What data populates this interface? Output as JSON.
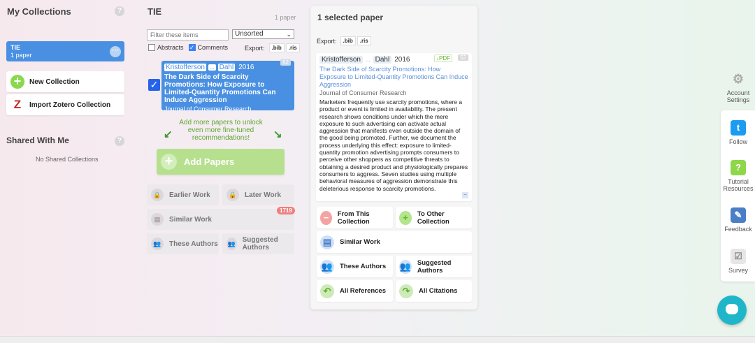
{
  "left": {
    "title": "My Collections",
    "collection": {
      "name": "TIE",
      "count": "1 paper"
    },
    "new_collection": "New Collection",
    "import_zotero": "Import Zotero Collection",
    "shared_title": "Shared With Me",
    "no_shared": "No Shared Collections"
  },
  "mid": {
    "title": "TIE",
    "count": "1 paper",
    "filter_placeholder": "Filter these items",
    "sort": "Unsorted",
    "abstracts": "Abstracts",
    "comments": "Comments",
    "export_label": "Export:",
    "bib": ".bib",
    "ris": ".ris",
    "paper": {
      "author1": "Kristofferson",
      "author_more": "...",
      "author2": "Dahl",
      "year": "2016",
      "badge": "52",
      "title": "The Dark Side of Scarcity Promotions: How Exposure to Limited-Quantity Promotions Can Induce Aggression",
      "journal": "Journal of Consumer Research"
    },
    "unlock_text": "Add more papers to unlock even more fine-tuned recommendations!",
    "add_papers": "Add Papers",
    "earlier": "Earlier Work",
    "later": "Later Work",
    "similar": "Similar Work",
    "similar_count": "1719",
    "these_authors": "These Authors",
    "suggested_authors": "Suggested Authors"
  },
  "right": {
    "title": "1 selected paper",
    "export_label": "Export:",
    "bib": ".bib",
    "ris": ".ris",
    "author1": "Kristofferson",
    "author_sep": "...",
    "author2": "Dahl",
    "year": "2016",
    "pdf": "↓PDF",
    "badge": "52",
    "title_text": "The Dark Side of Scarcity Promotions: How Exposure to Limited-Quantity Promotions Can Induce Aggression",
    "journal": "Journal of Consumer Research",
    "abstract": "Marketers frequently use scarcity promotions, where a product or event is limited in availability. The present research shows conditions under which the mere exposure to such advertising can activate actual aggression that manifests even outside the domain of the good being promoted. Further, we document the process underlying this effect: exposure to limited-quantity promotion advertising prompts consumers to perceive other shoppers as competitive threats to obtaining a desired product and physiologically prepares consumers to aggress. Seven studies using multiple behavioral measures of aggression demonstrate this deleterious response to scarcity promotions.",
    "from_collection": "From This Collection",
    "to_collection": "To Other Collection",
    "similar": "Similar Work",
    "these_authors": "These Authors",
    "suggested_authors": "Suggested Authors",
    "all_refs": "All References",
    "all_cites": "All Citations"
  },
  "sidebar": {
    "account": "Account Settings",
    "follow": "Follow",
    "tutorial": "Tutorial Resources",
    "feedback": "Feedback",
    "survey": "Survey"
  }
}
